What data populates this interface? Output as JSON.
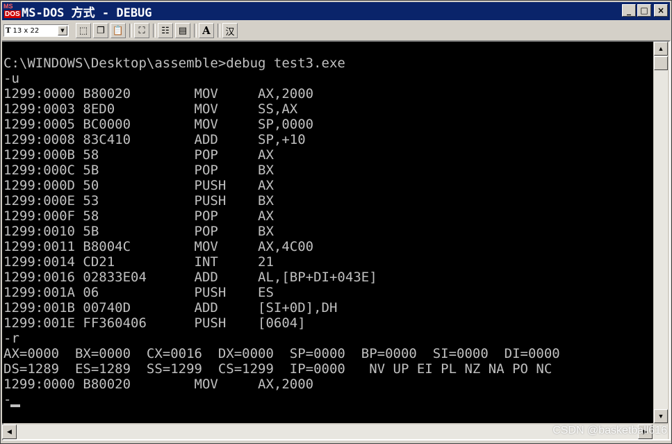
{
  "window": {
    "title": "MS-DOS 方式 - DEBUG",
    "icon_top": "MS",
    "icon_bottom": "DOS",
    "minimize_glyph": "_",
    "maximize_glyph": "□",
    "close_glyph": "×",
    "colors": {
      "titlebar": "#0a246a",
      "console_bg": "#000000",
      "console_text": "#c0c0c0",
      "chrome": "#d4d0c8"
    }
  },
  "toolbar": {
    "font_size_prefix": "T",
    "font_size_value": "13 x 22",
    "buttons": [
      {
        "name": "mark-icon",
        "glyph": "⬚"
      },
      {
        "name": "copy-icon",
        "glyph": "❐"
      },
      {
        "name": "paste-icon",
        "glyph": "📋"
      },
      {
        "name": "fullscreen-icon",
        "glyph": "⛶"
      },
      {
        "name": "properties-icon",
        "glyph": "☷"
      },
      {
        "name": "background-icon",
        "glyph": "▤"
      },
      {
        "name": "font-icon",
        "glyph": "A"
      },
      {
        "name": "chinese-input-icon",
        "glyph": "汉"
      }
    ]
  },
  "console": {
    "lines": [
      "",
      "C:\\WINDOWS\\Desktop\\assemble>debug test3.exe",
      "-u",
      "1299:0000 B80020        MOV     AX,2000",
      "1299:0003 8ED0          MOV     SS,AX",
      "1299:0005 BC0000        MOV     SP,0000",
      "1299:0008 83C410        ADD     SP,+10",
      "1299:000B 58            POP     AX",
      "1299:000C 5B            POP     BX",
      "1299:000D 50            PUSH    AX",
      "1299:000E 53            PUSH    BX",
      "1299:000F 58            POP     AX",
      "1299:0010 5B            POP     BX",
      "1299:0011 B8004C        MOV     AX,4C00",
      "1299:0014 CD21          INT     21",
      "1299:0016 02833E04      ADD     AL,[BP+DI+043E]",
      "1299:001A 06            PUSH    ES",
      "1299:001B 00740D        ADD     [SI+0D],DH",
      "1299:001E FF360406      PUSH    [0604]",
      "-r",
      "AX=0000  BX=0000  CX=0016  DX=0000  SP=0000  BP=0000  SI=0000  DI=0000",
      "DS=1289  ES=1289  SS=1299  CS=1299  IP=0000   NV UP EI PL NZ NA PO NC",
      "1299:0000 B80020        MOV     AX,2000",
      "-"
    ]
  },
  "scrollbars": {
    "up_glyph": "▲",
    "down_glyph": "▼",
    "left_glyph": "◀",
    "right_glyph": "▶"
  },
  "watermark": "CSDN @basketball616"
}
